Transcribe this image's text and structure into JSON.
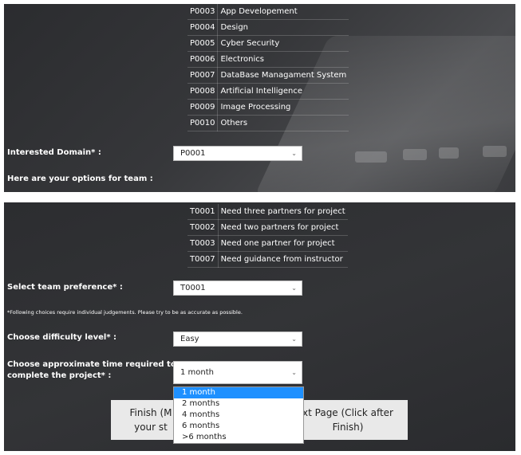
{
  "domains": [
    {
      "code": "P0003",
      "name": "App Developement"
    },
    {
      "code": "P0004",
      "name": "Design"
    },
    {
      "code": "P0005",
      "name": "Cyber Security"
    },
    {
      "code": "P0006",
      "name": "Electronics"
    },
    {
      "code": "P0007",
      "name": "DataBase Managament System"
    },
    {
      "code": "P0008",
      "name": "Artificial Intelligence"
    },
    {
      "code": "P0009",
      "name": "Image Processing"
    },
    {
      "code": "P0010",
      "name": "Others"
    }
  ],
  "domain_field": {
    "label": "Interested Domain* :",
    "value": "P0001"
  },
  "team_intro": "Here are your options for team :",
  "teams": [
    {
      "code": "T0001",
      "name": "Need three partners for project"
    },
    {
      "code": "T0002",
      "name": "Need two partners for project"
    },
    {
      "code": "T0003",
      "name": "Need one partner for project"
    },
    {
      "code": "T0007",
      "name": "Need guidance from instructor"
    }
  ],
  "team_field": {
    "label": "Select team preference* :",
    "value": "T0001"
  },
  "note": "*Following choices require individual judgements. Please try to be as accurate as possible.",
  "difficulty_field": {
    "label": "Choose difficulty level* :",
    "value": "Easy"
  },
  "time_field": {
    "label_line1": "Choose approximate time required to",
    "label_line2": "complete the project* :",
    "value": "1 month",
    "options": [
      "1 month",
      "2 months",
      "4 months",
      "6 months",
      ">6 months"
    ],
    "selected_index": 0
  },
  "buttons": {
    "finish_line1": "Finish (M",
    "finish_line2": "your st",
    "next_line1": "xt Page (Click after",
    "next_line2": "Finish)"
  },
  "colors": {
    "panel": "#333437",
    "highlight": "#1e90ff",
    "button": "#e9e9e9"
  }
}
